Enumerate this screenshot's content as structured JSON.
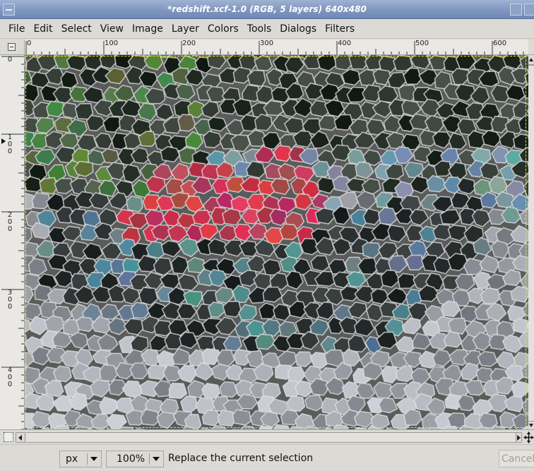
{
  "window": {
    "title": "*redshift.xcf-1.0 (RGB, 5 layers) 640x480"
  },
  "menubar": {
    "items": [
      "File",
      "Edit",
      "Select",
      "View",
      "Image",
      "Layer",
      "Colors",
      "Tools",
      "Dialogs",
      "Filters"
    ]
  },
  "rulers": {
    "horizontal_labels": [
      "0",
      "100",
      "200",
      "300",
      "400",
      "500",
      "600"
    ],
    "vertical_labels": [
      "0",
      "100",
      "200",
      "300",
      "400"
    ]
  },
  "image": {
    "description_icon": "mosaic-filtered-photo-icon"
  },
  "statusbar": {
    "unit": "px",
    "zoom": "100%",
    "message": "Replace the current selection",
    "cancel_label": "Cancel"
  },
  "colors": {
    "titlebar": "#7f96c0",
    "selection": "#e8e81c"
  }
}
